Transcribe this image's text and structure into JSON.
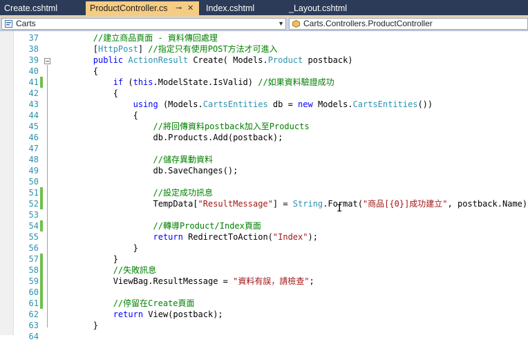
{
  "tabs": [
    {
      "label": "Create.cshtml",
      "active": false
    },
    {
      "label": "ProductController.cs",
      "active": true
    },
    {
      "label": "Index.cshtml",
      "active": false
    },
    {
      "label": "_Layout.cshtml",
      "active": false
    }
  ],
  "navbar": {
    "project": "Carts",
    "member": "Carts.Controllers.ProductController"
  },
  "colors": {
    "tab_bar": "#2b3b58",
    "active_tab": "#f5cc84",
    "keyword": "#0000ff",
    "type": "#2b91af",
    "comment": "#008000",
    "string": "#a31515",
    "line_number": "#2b91af",
    "change_marker": "#6cc24a"
  },
  "icons": {
    "pin": "pin-icon",
    "close": "close-icon",
    "project": "csharp-project-icon",
    "class": "class-icon",
    "dropdown": "chevron-down-icon"
  },
  "lines": [
    {
      "n": "37",
      "changed": false,
      "tokens": [
        [
          "        ",
          "p"
        ],
        [
          "//建立商品頁面 - 資料傳回處理",
          "cm"
        ]
      ]
    },
    {
      "n": "38",
      "changed": false,
      "tokens": [
        [
          "        [",
          "p"
        ],
        [
          "HttpPost",
          "ty"
        ],
        [
          "] ",
          "p"
        ],
        [
          "//指定只有使用POST方法才可進入",
          "cm"
        ]
      ]
    },
    {
      "n": "39",
      "changed": false,
      "tokens": [
        [
          "        ",
          "p"
        ],
        [
          "public",
          "kw"
        ],
        [
          " ",
          "p"
        ],
        [
          "ActionResult",
          "ty"
        ],
        [
          " Create( Models.",
          "p"
        ],
        [
          "Product",
          "ty"
        ],
        [
          " postback)",
          "p"
        ]
      ]
    },
    {
      "n": "40",
      "changed": false,
      "tokens": [
        [
          "        {",
          "p"
        ]
      ]
    },
    {
      "n": "41",
      "changed": true,
      "tokens": [
        [
          "            ",
          "p"
        ],
        [
          "if",
          "kw"
        ],
        [
          " (",
          "p"
        ],
        [
          "this",
          "kw"
        ],
        [
          ".ModelState.IsValid) ",
          "p"
        ],
        [
          "//如果資料驗證成功",
          "cm"
        ]
      ]
    },
    {
      "n": "42",
      "changed": false,
      "tokens": [
        [
          "            {",
          "p"
        ]
      ]
    },
    {
      "n": "43",
      "changed": false,
      "tokens": [
        [
          "                ",
          "p"
        ],
        [
          "using",
          "kw"
        ],
        [
          " (Models.",
          "p"
        ],
        [
          "CartsEntities",
          "ty"
        ],
        [
          " db = ",
          "p"
        ],
        [
          "new",
          "kw"
        ],
        [
          " Models.",
          "p"
        ],
        [
          "CartsEntities",
          "ty"
        ],
        [
          "())",
          "p"
        ]
      ]
    },
    {
      "n": "44",
      "changed": false,
      "tokens": [
        [
          "                {",
          "p"
        ]
      ]
    },
    {
      "n": "45",
      "changed": false,
      "tokens": [
        [
          "                    ",
          "p"
        ],
        [
          "//將回傳資料postback加入至Products",
          "cm"
        ]
      ]
    },
    {
      "n": "46",
      "changed": false,
      "tokens": [
        [
          "                    db.Products.Add(postback);",
          "p"
        ]
      ]
    },
    {
      "n": "47",
      "changed": false,
      "tokens": [
        [
          "",
          "p"
        ]
      ]
    },
    {
      "n": "48",
      "changed": false,
      "tokens": [
        [
          "                    ",
          "p"
        ],
        [
          "//儲存異動資料",
          "cm"
        ]
      ]
    },
    {
      "n": "49",
      "changed": false,
      "tokens": [
        [
          "                    db.SaveChanges();",
          "p"
        ]
      ]
    },
    {
      "n": "50",
      "changed": false,
      "tokens": [
        [
          "",
          "p"
        ]
      ]
    },
    {
      "n": "51",
      "changed": true,
      "tokens": [
        [
          "                    ",
          "p"
        ],
        [
          "//設定成功訊息",
          "cm"
        ]
      ]
    },
    {
      "n": "52",
      "changed": true,
      "tokens": [
        [
          "                    TempData[",
          "p"
        ],
        [
          "\"ResultMessage\"",
          "st"
        ],
        [
          "] = ",
          "p"
        ],
        [
          "String",
          "ty"
        ],
        [
          ".Format(",
          "p"
        ],
        [
          "\"商品[{0}]成功建立\"",
          "st"
        ],
        [
          ", postback.Name);",
          "p"
        ]
      ]
    },
    {
      "n": "53",
      "changed": false,
      "tokens": [
        [
          "",
          "p"
        ]
      ]
    },
    {
      "n": "54",
      "changed": true,
      "tokens": [
        [
          "                    ",
          "p"
        ],
        [
          "//轉導Product/Index頁面",
          "cm"
        ]
      ]
    },
    {
      "n": "55",
      "changed": false,
      "tokens": [
        [
          "                    ",
          "p"
        ],
        [
          "return",
          "kw"
        ],
        [
          " RedirectToAction(",
          "p"
        ],
        [
          "\"Index\"",
          "st"
        ],
        [
          ");",
          "p"
        ]
      ]
    },
    {
      "n": "56",
      "changed": false,
      "tokens": [
        [
          "                }",
          "p"
        ]
      ]
    },
    {
      "n": "57",
      "changed": true,
      "tokens": [
        [
          "            }",
          "p"
        ]
      ]
    },
    {
      "n": "58",
      "changed": true,
      "tokens": [
        [
          "            ",
          "p"
        ],
        [
          "//失敗訊息",
          "cm"
        ]
      ]
    },
    {
      "n": "59",
      "changed": true,
      "tokens": [
        [
          "            ViewBag.ResultMessage = ",
          "p"
        ],
        [
          "\"資料有誤，請檢查\"",
          "st"
        ],
        [
          ";",
          "p"
        ]
      ]
    },
    {
      "n": "60",
      "changed": true,
      "tokens": [
        [
          "",
          "p"
        ]
      ]
    },
    {
      "n": "61",
      "changed": true,
      "tokens": [
        [
          "            ",
          "p"
        ],
        [
          "//停留在Create頁面",
          "cm"
        ]
      ]
    },
    {
      "n": "62",
      "changed": false,
      "tokens": [
        [
          "            ",
          "p"
        ],
        [
          "return",
          "kw"
        ],
        [
          " View(postback);",
          "p"
        ]
      ]
    },
    {
      "n": "63",
      "changed": false,
      "tokens": [
        [
          "        }",
          "p"
        ]
      ]
    },
    {
      "n": "64",
      "changed": false,
      "tokens": [
        [
          "",
          "p"
        ]
      ]
    }
  ]
}
